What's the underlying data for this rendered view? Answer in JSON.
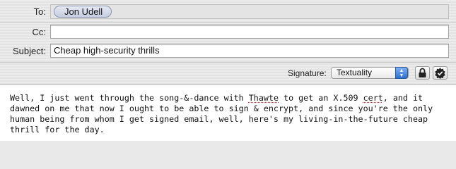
{
  "header": {
    "to_label": "To:",
    "to_recipients": [
      "Jon Udell"
    ],
    "cc_label": "Cc:",
    "cc_value": "",
    "subject_label": "Subject:",
    "subject_value": "Cheap high-security thrills"
  },
  "signature": {
    "label": "Signature:",
    "selected": "Textuality",
    "icons": [
      "lock-icon",
      "certificate-badge-icon"
    ]
  },
  "body": {
    "text_parts": [
      "Well, I just went through the song-&-dance with ",
      "Thawte",
      " to get an X.509 ",
      "cert",
      ", and it\ndawned on me that now I ought to be able to sign & encrypt, and since you're the only\nhuman being from whom I get signed email, well, here's my living-in-the-future cheap\nthrill for the day."
    ]
  },
  "colors": {
    "accent": "#2f6fd1",
    "token_bg": "#c5cde0",
    "spell_underline": "#d12b2b"
  }
}
